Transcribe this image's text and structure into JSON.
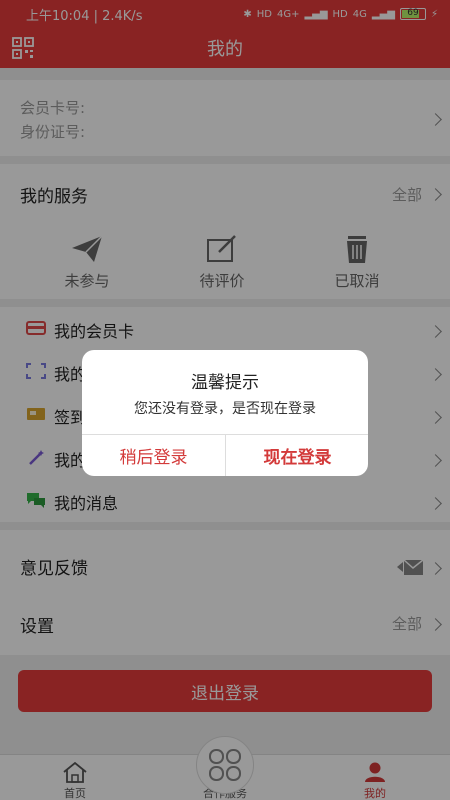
{
  "status_bar": {
    "time": "上午10:04 | 2.4K/s",
    "network_labels": [
      "HD",
      "4G+",
      "HD",
      "4G"
    ],
    "battery": "69"
  },
  "header": {
    "title": "我的"
  },
  "member_info": {
    "card_no_label": "会员卡号:",
    "id_no_label": "身份证号:"
  },
  "services": {
    "title": "我的服务",
    "all_label": "全部",
    "items": [
      {
        "label": "未参与",
        "icon": "paper-plane-icon"
      },
      {
        "label": "待评价",
        "icon": "edit-icon"
      },
      {
        "label": "已取消",
        "icon": "trash-icon"
      }
    ]
  },
  "menu": {
    "items": [
      {
        "label": "我的会员卡",
        "icon": "card-icon",
        "color": "#e04a4a"
      },
      {
        "label": "我的",
        "icon": "scan-icon",
        "color": "#7a7adf"
      },
      {
        "label": "签到",
        "icon": "coupon-icon",
        "color": "#d9a52e"
      },
      {
        "label": "我的",
        "icon": "magic-wand-icon",
        "color": "#7a5ad6"
      },
      {
        "label": "我的消息",
        "icon": "chat-icon",
        "color": "#36b54a"
      }
    ]
  },
  "misc": {
    "feedback_label": "意见反馈",
    "settings_label": "设置",
    "settings_all_label": "全部"
  },
  "logout_label": "退出登录",
  "tabbar": {
    "home": "首页",
    "partner": "合作服务",
    "mine": "我的"
  },
  "dialog": {
    "title": "温馨提示",
    "message": "您还没有登录，是否现在登录",
    "later_label": "稍后登录",
    "now_label": "现在登录"
  },
  "colors": {
    "accent": "#e53b3b",
    "dialog_button": "#d33a3a"
  }
}
